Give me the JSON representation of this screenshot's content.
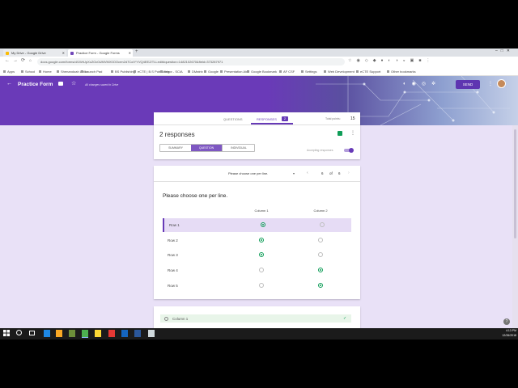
{
  "browser": {
    "tabs": [
      {
        "label": "My Drive - Google Drive",
        "color": "#fbbc04"
      },
      {
        "label": "Practice Form - Google Forms",
        "color": "#7248b9"
      }
    ],
    "url": "docs.google.com/forms/d/1WrUpXcZOc0UMVMX0OOcrm2d7CoIYYVQ4EEZ/TLLedit#question=1482102670&field=373287971",
    "bookmarks": [
      "Apps",
      "School",
      "Home",
      "Shenandoah Links",
      "Launch Pad",
      "BS Publishing",
      "eCTE | B.S Publishing",
      "Inbox - SCIA",
      "DMatrix",
      "Google",
      "Presentation Aids",
      "Google Bookmark",
      "AF CSF",
      "Settings",
      "Web Development",
      "eCTE Support",
      "Other bookmarks"
    ]
  },
  "forms_header": {
    "title": "Practice Form",
    "save_status": "All changes saved in Drive",
    "send_label": "SEND"
  },
  "tabs_card": {
    "questions_label": "QUESTIONS",
    "responses_label": "RESPONSES",
    "responses_count": "2",
    "total_points_label": "Total points:",
    "total_points_value": "15",
    "responses_heading": "2 responses",
    "view_tabs": [
      "SUMMARY",
      "QUESTION",
      "INDIVIDUAL"
    ],
    "accepting_label": "Accepting responses"
  },
  "question_nav": {
    "selected": "Please choose one per line.",
    "page_current": "6",
    "page_of": "of",
    "page_total": "6"
  },
  "grid_question": {
    "title": "Please choose one per line.",
    "columns": [
      "Column 1",
      "Column 2"
    ],
    "rows": [
      {
        "label": "Row 1",
        "selected_column": 1
      },
      {
        "label": "Row 2",
        "selected_column": 1
      },
      {
        "label": "Row 3",
        "selected_column": 1
      },
      {
        "label": "Row 4",
        "selected_column": 2
      },
      {
        "label": "Row 5",
        "selected_column": 2
      }
    ],
    "accent_color": "#0f9d58"
  },
  "answer_card": {
    "option_label": "Column 1"
  },
  "taskbar": {
    "time": "4:13 PM",
    "date": "12/26/2018"
  },
  "colors": {
    "forms_purple": "#673ab7",
    "background": "#e9e1f7",
    "green": "#0f9d58"
  }
}
